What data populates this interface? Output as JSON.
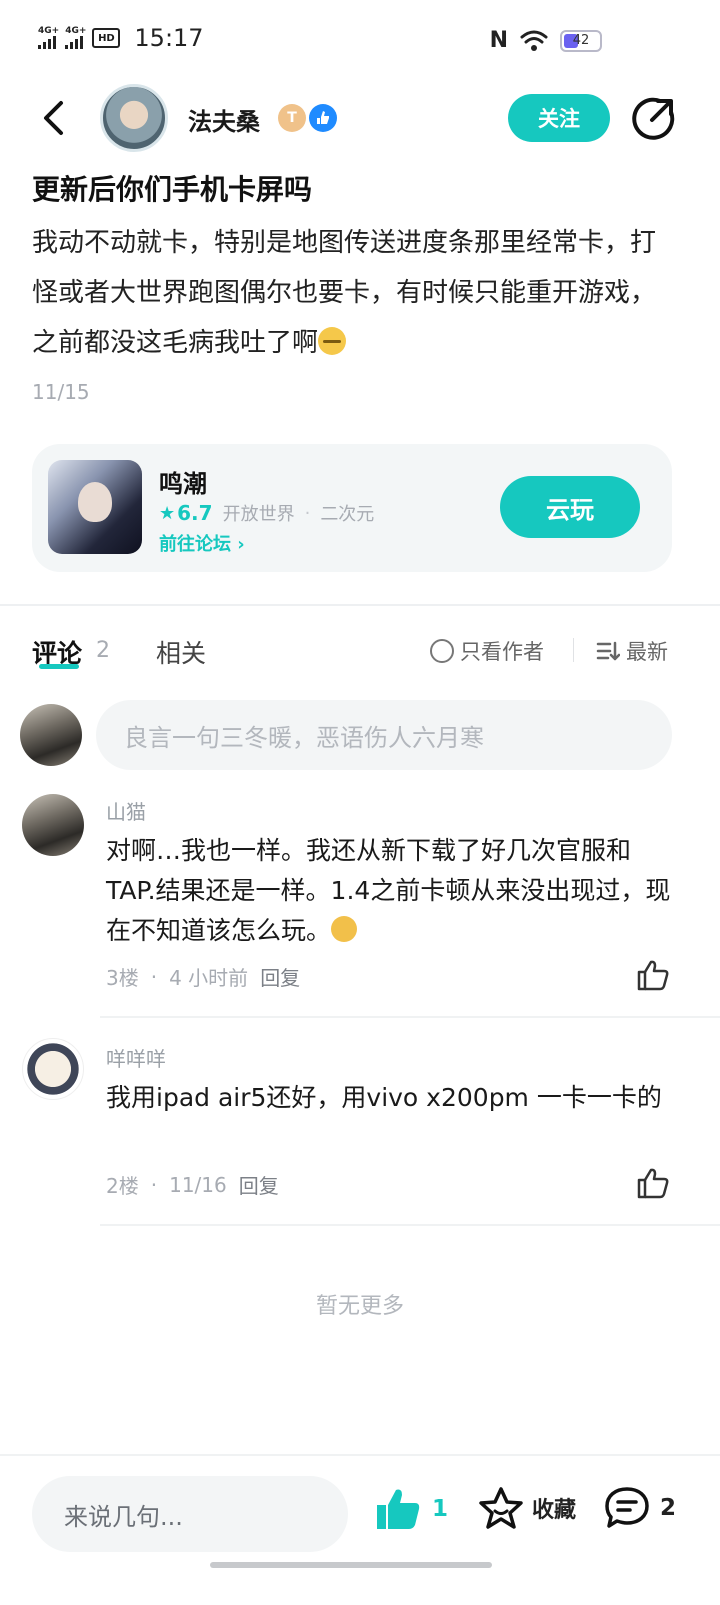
{
  "status_bar": {
    "signal1": "4G+",
    "signal2": "4G+",
    "hd": "HD",
    "time": "15:17",
    "nfc": "N",
    "battery": "42"
  },
  "author": {
    "name": "法夫桑",
    "badge_t": "T",
    "follow_label": "关注"
  },
  "post": {
    "title": "更新后你们手机卡屏吗",
    "body": "我动不动就卡，特别是地图传送进度条那里经常卡，打怪或者大世界跑图偶尔也要卡，有时候只能重开游戏，之前都没这毛病我吐了啊",
    "date": "11/15"
  },
  "game": {
    "name": "鸣潮",
    "score": "6.7",
    "tag1": "开放世界",
    "tag2": "二次元",
    "forum_link": "前往论坛",
    "cloud_play": "云玩"
  },
  "tabs": {
    "comments": "评论",
    "comments_count": "2",
    "related": "相关",
    "only_author": "只看作者",
    "sort": "最新"
  },
  "comment_input": {
    "placeholder": "良言一句三冬暖，恶语伤人六月寒"
  },
  "comments": [
    {
      "user": "山猫",
      "text": "对啊…我也一样。我还从新下载了好几次官服和TAP.结果还是一样。1.4之前卡顿从来没出现过，现在不知道该怎么玩。",
      "floor": "3楼",
      "time": "4 小时前",
      "reply": "回复"
    },
    {
      "user": "咩咩咩",
      "text": "我用ipad air5还好，用vivo x200pm 一卡一卡的",
      "floor": "2楼",
      "time": "11/16",
      "reply": "回复"
    }
  ],
  "no_more": "暂无更多",
  "bottom_bar": {
    "say_placeholder": "来说几句...",
    "like_count": "1",
    "favorite_label": "收藏",
    "comment_count": "2"
  },
  "colors": {
    "accent": "#16c8bf",
    "muted": "#a7abb2"
  }
}
